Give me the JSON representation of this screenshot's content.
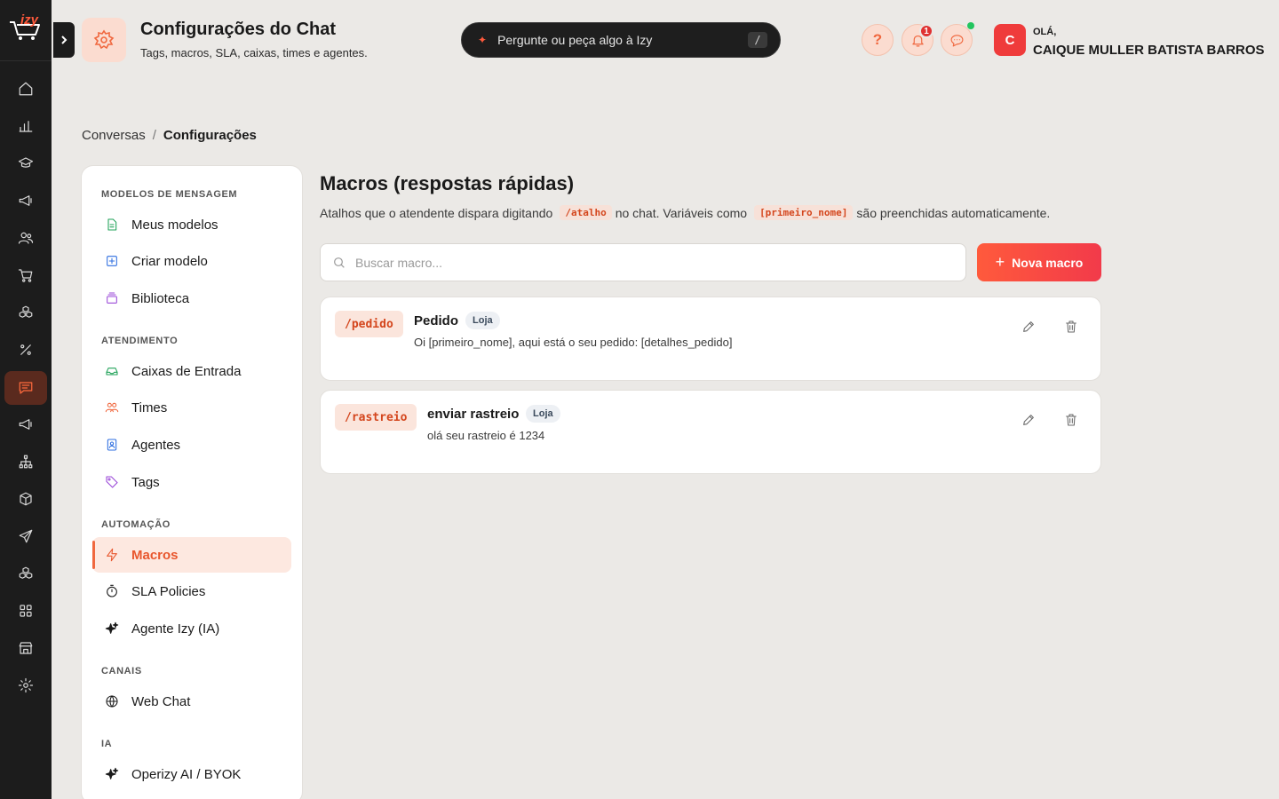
{
  "brand": {
    "logo_text": "izy",
    "accent": "#f0683f"
  },
  "rail": {
    "icons": [
      "home-icon",
      "chart-icon",
      "graduation-cap-icon",
      "megaphone-icon",
      "users-icon",
      "cart-icon",
      "cubes-icon",
      "percent-icon",
      "chat-icon",
      "megaphone-icon",
      "network-icon",
      "box-icon",
      "send-icon",
      "cubes-icon",
      "grid-icon",
      "store-icon",
      "gear-icon"
    ],
    "active_icon": "chat-icon"
  },
  "header": {
    "title": "Configurações do Chat",
    "subtitle": "Tags, macros, SLA, caixas, times e agentes.",
    "ask_placeholder": "Pergunte ou peça algo à Izy",
    "ask_shortcut": "/",
    "help_label": "?",
    "notifications_count": "1",
    "greeting": "OLÁ,",
    "user_name": "CAIQUE MULLER BATISTA BARROS",
    "avatar_initial": "C"
  },
  "breadcrumb": {
    "parent": "Conversas",
    "separator": "/",
    "current": "Configurações"
  },
  "nav": {
    "sections": [
      {
        "title": "MODELOS DE MENSAGEM",
        "items": [
          {
            "label": "Meus modelos",
            "icon": "document-icon"
          },
          {
            "label": "Criar modelo",
            "icon": "plus-square-icon"
          },
          {
            "label": "Biblioteca",
            "icon": "library-icon"
          }
        ]
      },
      {
        "title": "ATENDIMENTO",
        "items": [
          {
            "label": "Caixas de Entrada",
            "icon": "inbox-icon"
          },
          {
            "label": "Times",
            "icon": "team-icon"
          },
          {
            "label": "Agentes",
            "icon": "agent-icon"
          },
          {
            "label": "Tags",
            "icon": "tag-icon"
          }
        ]
      },
      {
        "title": "AUTOMAÇÃO",
        "items": [
          {
            "label": "Macros",
            "icon": "lightning-icon"
          },
          {
            "label": "SLA Policies",
            "icon": "timer-icon"
          },
          {
            "label": "Agente Izy (IA)",
            "icon": "sparkle-icon"
          }
        ]
      },
      {
        "title": "CANAIS",
        "items": [
          {
            "label": "Web Chat",
            "icon": "globe-icon"
          }
        ]
      },
      {
        "title": "IA",
        "items": [
          {
            "label": "Operizy AI / BYOK",
            "icon": "sparkle-icon"
          }
        ]
      }
    ],
    "active": "Macros"
  },
  "main": {
    "title": "Macros (respostas rápidas)",
    "desc_1": "Atalhos que o atendente dispara digitando",
    "desc_code_1": "/atalho",
    "desc_2": "no chat. Variáveis como",
    "desc_code_2": "[primeiro_nome]",
    "desc_3": "são preenchidas automaticamente.",
    "search_placeholder": "Buscar macro...",
    "new_button": "Nova macro",
    "macros": [
      {
        "shortcut": "/pedido",
        "name": "Pedido",
        "tag": "Loja",
        "body": "Oi [primeiro_nome], aqui está o seu pedido: [detalhes_pedido]"
      },
      {
        "shortcut": "/rastreio",
        "name": "enviar rastreio",
        "tag": "Loja",
        "body": "olá seu rastreio é 1234"
      }
    ]
  }
}
